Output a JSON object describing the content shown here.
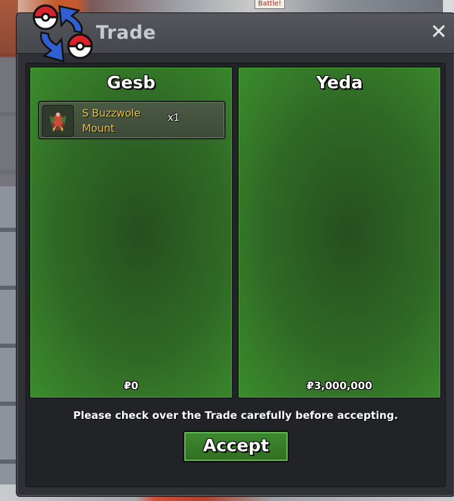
{
  "background": {
    "battle_label": "Battle!"
  },
  "window": {
    "title": "Trade",
    "close_label": "✕",
    "icon": "trade-arrows-icon"
  },
  "trade": {
    "left": {
      "player": "Gesb",
      "items": [
        {
          "name": "S Buzzwole Mount",
          "quantity": "x1",
          "icon": "buzzwole-sprite-icon"
        }
      ],
      "money": "₽0"
    },
    "right": {
      "player": "Yeda",
      "items": [],
      "money": "₽3,000,000"
    }
  },
  "notice": "Please check over the Trade carefully before accepting.",
  "accept_label": "Accept",
  "colors": {
    "panel_green": "#2f6a25",
    "item_name_gold": "#e9c43f",
    "window_dark": "#2f3035"
  }
}
